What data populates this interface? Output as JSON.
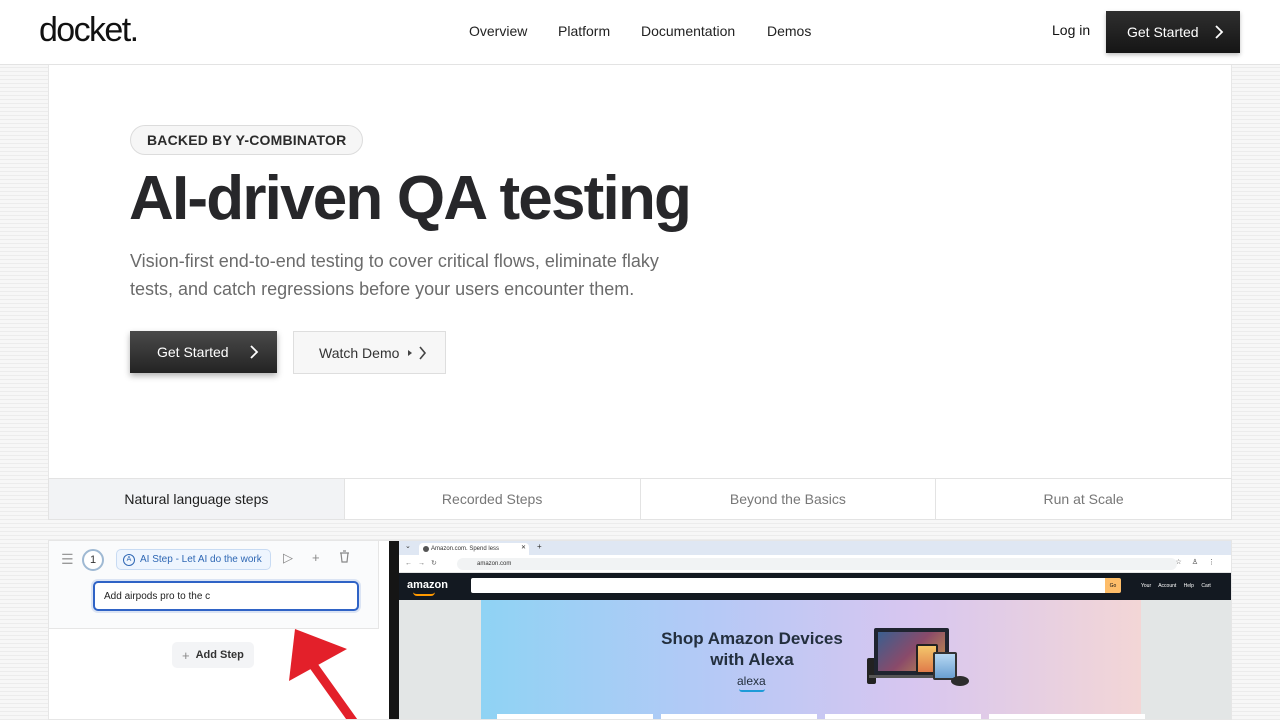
{
  "brand": {
    "logo": "docket."
  },
  "nav": {
    "links": [
      "Overview",
      "Platform",
      "Documentation",
      "Demos"
    ],
    "login": "Log in",
    "cta": "Get Started"
  },
  "hero": {
    "badge": "BACKED BY Y-COMBINATOR",
    "title": "AI-driven QA testing",
    "subtitle": "Vision-first end-to-end testing to cover critical flows, eliminate flaky tests, and catch regressions before your users encounter them.",
    "primary_cta": "Get Started",
    "secondary_cta": "Watch Demo"
  },
  "tabs": [
    {
      "label": "Natural language steps",
      "active": true
    },
    {
      "label": "Recorded Steps",
      "active": false
    },
    {
      "label": "Beyond the Basics",
      "active": false
    },
    {
      "label": "Run at Scale",
      "active": false
    }
  ],
  "demo": {
    "step": {
      "number": "1",
      "chip": "AI Step - Let AI do the work",
      "input_value": "Add airpods pro to the c",
      "tools": [
        "play-icon",
        "plus-icon",
        "trash-icon"
      ]
    },
    "add_step": "Add Step",
    "browser": {
      "tab_title": "Amazon.com. Spend less",
      "url": "amazon.com",
      "site_logo": "amazon",
      "search_button": "Go",
      "header_links": "Your Account  Help  Cart",
      "promo_title": "Shop Amazon Devices with Alexa",
      "promo_brand": "alexa"
    }
  },
  "colors": {
    "accent_dark": "#1a1a1a",
    "input_focus": "#2f63c6",
    "annotation_arrow": "#e3202a",
    "amazon_header": "#131921",
    "amazon_search_button": "#febd69"
  }
}
